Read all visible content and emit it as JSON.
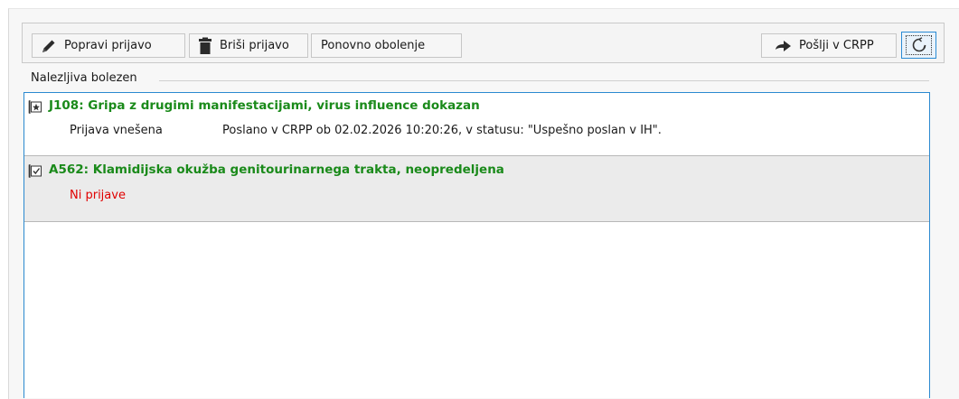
{
  "toolbar": {
    "edit_label": "Popravi prijavo",
    "delete_label": "Briši prijavo",
    "again_label": "Ponovno obolenje",
    "send_label": "Pošlji v CRPP",
    "refresh_icon": "refresh-icon"
  },
  "group": {
    "label": "Nalezljiva bolezen"
  },
  "items": [
    {
      "title": "J108: Gripa z drugimi manifestacijami, virus influence dokazan",
      "icon": "star-checkbox-icon",
      "status_label": "Prijava vnešena",
      "status_detail": "Poslano v CRPP ob 02.02.2026 10:20:26, v statusu: \"Uspešno poslan v IH\"."
    },
    {
      "title": "A562: Klamidijska okužba genitourinarnega trakta, neopredeljena",
      "icon": "checked-checkbox-icon",
      "no_report": "Ni prijave"
    }
  ],
  "colors": {
    "accent_border": "#2b89d0",
    "title_green": "#1a8a1a",
    "warning_red": "#e00000"
  }
}
